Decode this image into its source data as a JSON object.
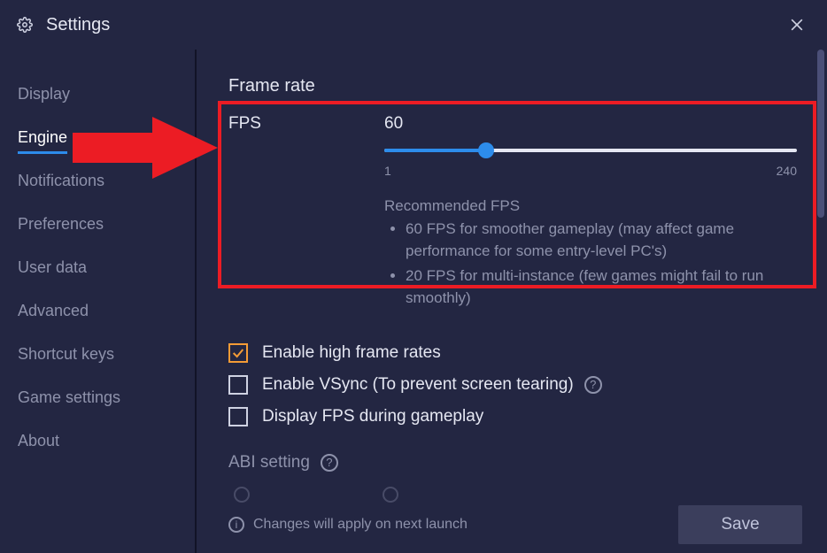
{
  "window": {
    "title": "Settings"
  },
  "sidebar": {
    "items": [
      {
        "label": "Display",
        "active": false
      },
      {
        "label": "Engine",
        "active": true
      },
      {
        "label": "Notifications",
        "active": false
      },
      {
        "label": "Preferences",
        "active": false
      },
      {
        "label": "User data",
        "active": false
      },
      {
        "label": "Advanced",
        "active": false
      },
      {
        "label": "Shortcut keys",
        "active": false
      },
      {
        "label": "Game settings",
        "active": false
      },
      {
        "label": "About",
        "active": false
      }
    ]
  },
  "frame_rate": {
    "section_title": "Frame rate",
    "label": "FPS",
    "value": 60,
    "min": 1,
    "max": 240,
    "recommend_title": "Recommended FPS",
    "recommend_items": [
      "60 FPS for smoother gameplay (may affect game performance for some entry-level PC's)",
      "20 FPS for multi-instance (few games might fail to run smoothly)"
    ]
  },
  "checks": {
    "high_frame": {
      "label": "Enable high frame rates",
      "checked": true
    },
    "vsync": {
      "label": "Enable VSync (To prevent screen tearing)",
      "checked": false
    },
    "show_fps": {
      "label": "Display FPS during gameplay",
      "checked": false
    }
  },
  "abi": {
    "label": "ABI setting"
  },
  "footer": {
    "notice": "Changes will apply on next launch",
    "save": "Save"
  },
  "annotation": {
    "highlight_color": "#ec1c24"
  }
}
